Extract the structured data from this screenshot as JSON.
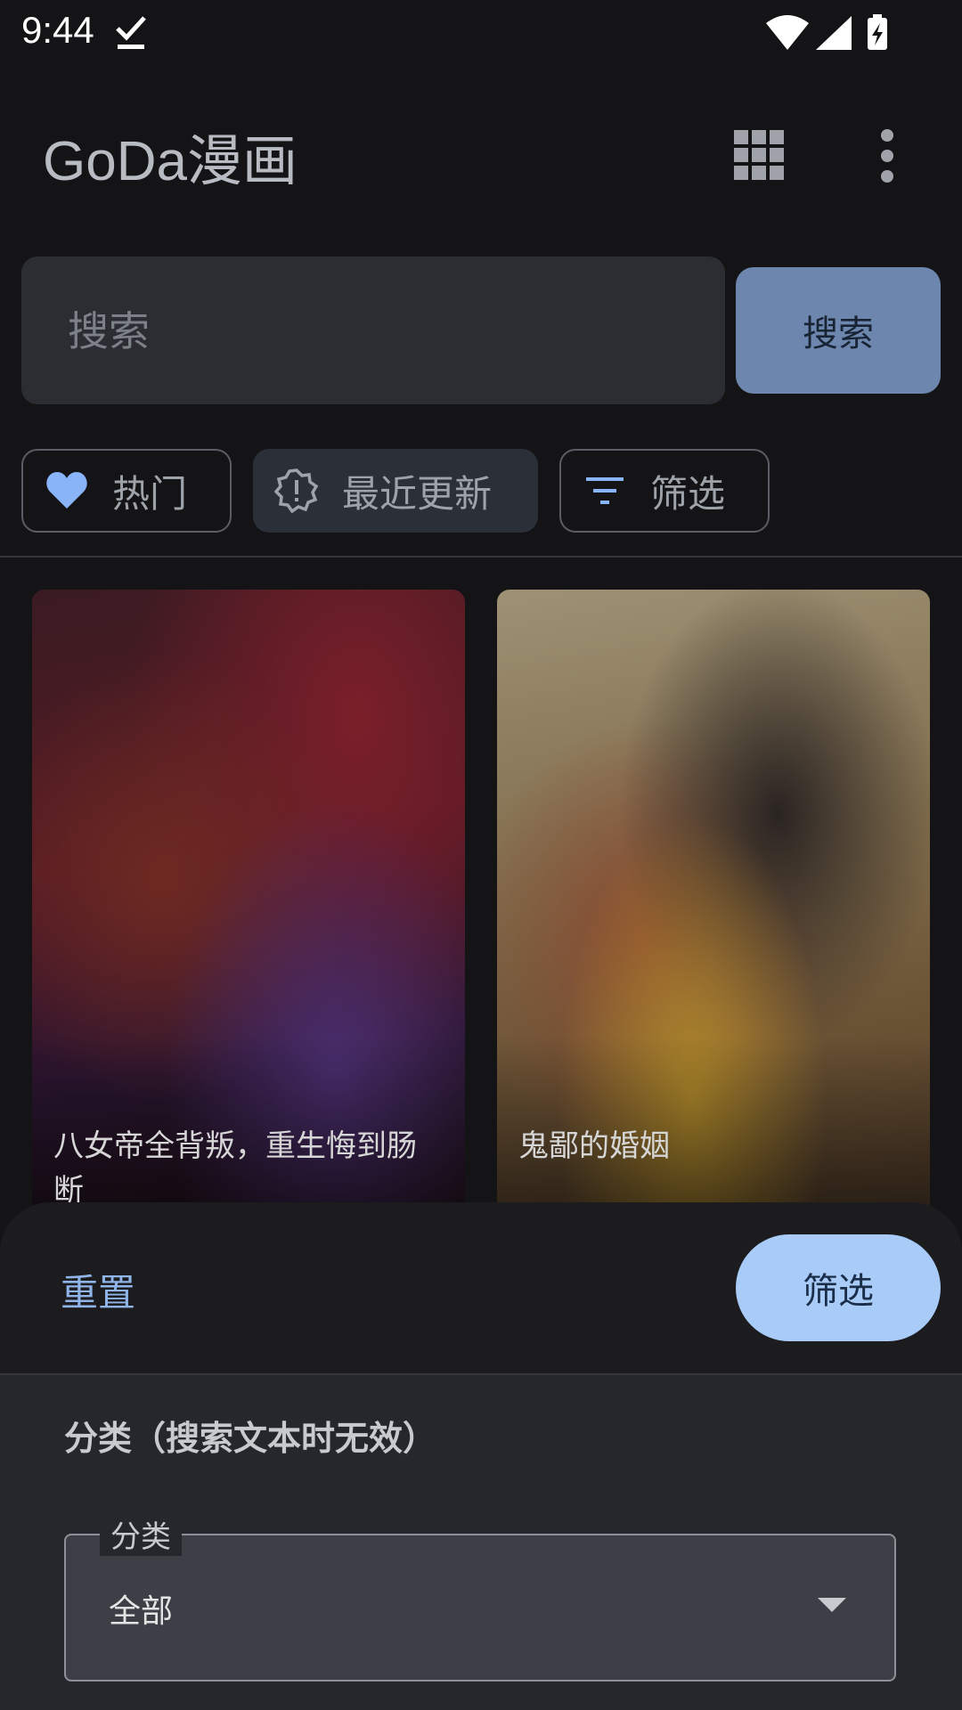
{
  "status_bar": {
    "time": "9:44",
    "icons": [
      "download-done-icon",
      "wifi-icon",
      "cell-signal-icon",
      "battery-charging-icon"
    ]
  },
  "app_bar": {
    "title": "GoDa漫画",
    "icons": [
      "grid-view-icon",
      "more-vert-icon"
    ]
  },
  "search": {
    "placeholder": "搜索",
    "button_label": "搜索"
  },
  "chips": [
    {
      "label": "热门",
      "icon": "heart-icon"
    },
    {
      "label": "最近更新",
      "icon": "new-releases-icon"
    },
    {
      "label": "筛选",
      "icon": "filter-icon"
    }
  ],
  "comics": [
    {
      "title": "八女帝全背叛，重生悔到肠断"
    },
    {
      "title": "鬼鄙的婚姻"
    }
  ],
  "filter_sheet": {
    "reset_label": "重置",
    "apply_label": "筛选",
    "section_title": "分类（搜索文本时无效）",
    "category_field": {
      "label": "分类",
      "value": "全部"
    }
  },
  "colors": {
    "background": "#141416",
    "search_button": "#6c86ad",
    "apply_button": "#a8cbf8",
    "accent_text": "#8fb4e8",
    "chip_icon": "#8ab4f8"
  }
}
